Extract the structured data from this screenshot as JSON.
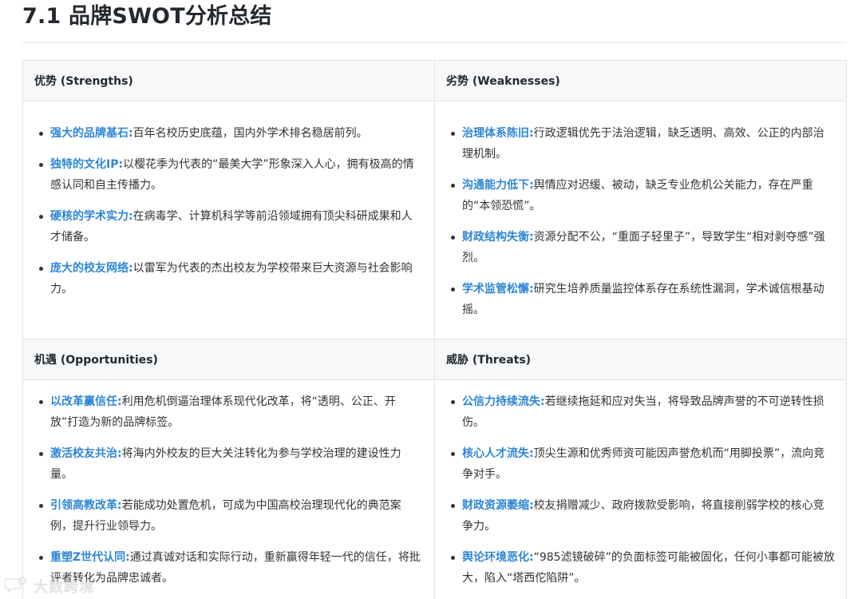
{
  "title": "7.1 品牌SWOT分析总结",
  "quadrants": [
    {
      "heading": "优势 (Strengths)",
      "items": [
        {
          "term": "强大的品牌基石:",
          "text": "百年名校历史底蕴，国内外学术排名稳居前列。"
        },
        {
          "term": "独特的文化IP:",
          "text": "以樱花季为代表的“最美大学”形象深入人心，拥有极高的情感认同和自主传播力。"
        },
        {
          "term": "硬核的学术实力:",
          "text": "在病毒学、计算机科学等前沿领域拥有顶尖科研成果和人才储备。"
        },
        {
          "term": "庞大的校友网络:",
          "text": "以雷军为代表的杰出校友为学校带来巨大资源与社会影响力。"
        }
      ]
    },
    {
      "heading": "劣势 (Weaknesses)",
      "items": [
        {
          "term": "治理体系陈旧:",
          "text": "行政逻辑优先于法治逻辑，缺乏透明、高效、公正的内部治理机制。"
        },
        {
          "term": "沟通能力低下:",
          "text": "舆情应对迟缓、被动，缺乏专业危机公关能力，存在严重的“本领恐慌”。"
        },
        {
          "term": "财政结构失衡:",
          "text": "资源分配不公，“重面子轻里子”，导致学生“相对剥夺感”强烈。"
        },
        {
          "term": "学术监管松懈:",
          "text": "研究生培养质量监控体系存在系统性漏洞，学术诚信根基动摇。"
        }
      ]
    },
    {
      "heading": "机遇 (Opportunities)",
      "items": [
        {
          "term": "以改革赢信任:",
          "text": "利用危机倒逼治理体系现代化改革，将“透明、公正、开放”打造为新的品牌标签。"
        },
        {
          "term": "激活校友共治:",
          "text": "将海内外校友的巨大关注转化为参与学校治理的建设性力量。"
        },
        {
          "term": "引领高教改革:",
          "text": "若能成功处置危机，可成为中国高校治理现代化的典范案例，提升行业领导力。"
        },
        {
          "term": "重塑Z世代认同:",
          "text": "通过真诚对话和实际行动，重新赢得年轻一代的信任，将批评者转化为品牌忠诚者。"
        }
      ]
    },
    {
      "heading": "威胁 (Threats)",
      "items": [
        {
          "term": "公信力持续流失:",
          "text": "若继续拖延和应对失当，将导致品牌声誉的不可逆转性损伤。"
        },
        {
          "term": "核心人才流失:",
          "text": "顶尖生源和优秀师资可能因声誉危机而“用脚投票”，流向竞争对手。"
        },
        {
          "term": "财政资源萎缩:",
          "text": "校友捐赠减少、政府拨款受影响，将直接削弱学校的核心竞争力。"
        },
        {
          "term": "舆论环境恶化:",
          "text": "“985滤镜破碎”的负面标签可能被固化，任何小事都可能被放大，陷入“塔西佗陷阱”。"
        }
      ]
    }
  ],
  "watermark": {
    "icon": "speech-bubble-logo-icon",
    "text": "大数跨境"
  }
}
